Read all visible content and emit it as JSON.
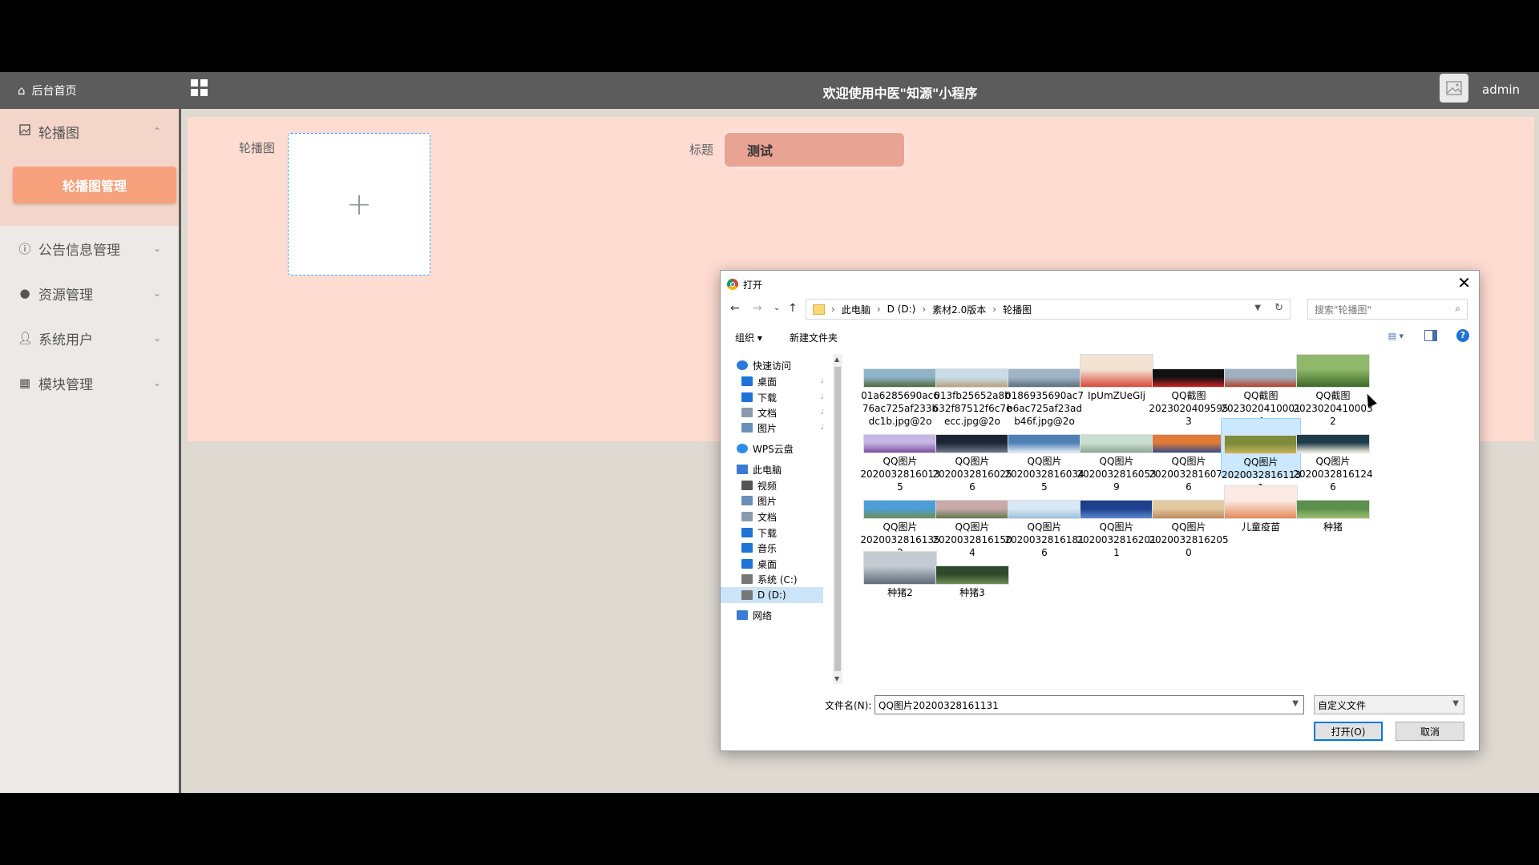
{
  "sidebar": {
    "home_label": "后台首页",
    "items": [
      {
        "label": "轮播图",
        "icon": "image-icon",
        "chevron": "⌃"
      },
      {
        "label": "公告信息管理",
        "icon": "info-icon",
        "chevron": "⌄"
      },
      {
        "label": "资源管理",
        "icon": "location-icon",
        "chevron": "⌄"
      },
      {
        "label": "系统用户",
        "icon": "user-icon",
        "chevron": "⌄"
      },
      {
        "label": "模块管理",
        "icon": "grid-icon",
        "chevron": "⌄"
      }
    ],
    "sub_active": "轮播图管理"
  },
  "header": {
    "title": "欢迎使用中医\"知源\"小程序",
    "user": "admin"
  },
  "form": {
    "carousel_label": "轮播图",
    "upload_plus": "+",
    "title_label": "标题",
    "title_value": "测试"
  },
  "dialog": {
    "title": "打开",
    "close": "✕",
    "nav": {
      "back": "←",
      "forward": "→",
      "recent": "⌄",
      "up": "↑"
    },
    "breadcrumb": [
      "此电脑",
      "D (D:)",
      "素材2.0版本",
      "轮播图"
    ],
    "breadcrumb_sep": "›",
    "search_placeholder": "搜索\"轮播图\"",
    "toolbar": {
      "organize": "组织 ▾",
      "new_folder": "新建文件夹",
      "help": "?"
    },
    "tree": [
      {
        "label": "快速访问",
        "icon": "star-icon",
        "indent": 0,
        "pin": false
      },
      {
        "label": "桌面",
        "icon": "desktop-icon",
        "indent": 1,
        "pin": true
      },
      {
        "label": "下载",
        "icon": "download-icon",
        "indent": 1,
        "pin": true
      },
      {
        "label": "文档",
        "icon": "document-icon",
        "indent": 1,
        "pin": true
      },
      {
        "label": "图片",
        "icon": "picture-icon",
        "indent": 1,
        "pin": true
      },
      {
        "label": "WPS云盘",
        "icon": "cloud-icon",
        "indent": 0,
        "pin": false
      },
      {
        "label": "此电脑",
        "icon": "computer-icon",
        "indent": 0,
        "pin": false
      },
      {
        "label": "视频",
        "icon": "video-icon",
        "indent": 1,
        "pin": false
      },
      {
        "label": "图片",
        "icon": "picture-icon",
        "indent": 1,
        "pin": false
      },
      {
        "label": "文档",
        "icon": "document-icon",
        "indent": 1,
        "pin": false
      },
      {
        "label": "下载",
        "icon": "download-icon",
        "indent": 1,
        "pin": false
      },
      {
        "label": "音乐",
        "icon": "music-icon",
        "indent": 1,
        "pin": false
      },
      {
        "label": "桌面",
        "icon": "desktop-icon",
        "indent": 1,
        "pin": false
      },
      {
        "label": "系统 (C:)",
        "icon": "drive-icon",
        "indent": 1,
        "pin": false
      },
      {
        "label": "D (D:)",
        "icon": "drive-icon",
        "indent": 1,
        "pin": false,
        "selected": true
      },
      {
        "label": "网络",
        "icon": "network-icon",
        "indent": 0,
        "pin": false
      }
    ],
    "files": [
      {
        "lines": [
          "01a6285690ac6",
          "76ac725af233b",
          "dc1b.jpg@2o"
        ],
        "colors": [
          "#8fb3c9",
          "#4f6b3a"
        ]
      },
      {
        "lines": [
          "013fb25652a8b",
          "632f87512f6c7e",
          "ecc.jpg@2o"
        ],
        "colors": [
          "#c9dde8",
          "#b7a37d"
        ]
      },
      {
        "lines": [
          "0186935690ac7",
          "b6ac725af23ad",
          "b46f.jpg@2o"
        ],
        "colors": [
          "#9fb4c6",
          "#5e6f7e"
        ]
      },
      {
        "lines": [
          "IpUmZUeGlj"
        ],
        "colors": [
          "#f3e3d3",
          "#d94b3c"
        ],
        "tall": true
      },
      {
        "lines": [
          "QQ截图",
          "2023020409595",
          "3"
        ],
        "colors": [
          "#111",
          "#c22"
        ]
      },
      {
        "lines": [
          "QQ截图",
          "2023020410001",
          "4"
        ],
        "colors": [
          "#9fb0c0",
          "#b4442c"
        ]
      },
      {
        "lines": [
          "QQ截图",
          "2023020410003",
          "2"
        ],
        "colors": [
          "#8fb86a",
          "#3c6a2a"
        ],
        "tall": true
      },
      {
        "lines": [
          "QQ图片",
          "2020032816013",
          "5"
        ],
        "colors": [
          "#c6b6e6",
          "#7b4f9e"
        ]
      },
      {
        "lines": [
          "QQ图片",
          "2020032816025",
          "6"
        ],
        "colors": [
          "#1b2535",
          "#6e7b8c"
        ]
      },
      {
        "lines": [
          "QQ图片",
          "2020032816034",
          "5"
        ],
        "colors": [
          "#4e7fb5",
          "#e3ecf4"
        ]
      },
      {
        "lines": [
          "QQ图片",
          "2020032816053",
          "9"
        ],
        "colors": [
          "#c9ddd0",
          "#8fa895"
        ]
      },
      {
        "lines": [
          "QQ图片",
          "2020032816074",
          "6"
        ],
        "colors": [
          "#e27b36",
          "#3a4b86"
        ]
      },
      {
        "lines": [
          "QQ图片",
          "2020032816113",
          "1"
        ],
        "colors": [
          "#7d8b3c",
          "#c8b55a"
        ],
        "selected": true
      },
      {
        "lines": [
          "QQ图片",
          "2020032816124",
          "6"
        ],
        "colors": [
          "#1d3c4a",
          "#f3f0e0"
        ]
      },
      {
        "lines": [
          "QQ图片",
          "2020032816135",
          "2"
        ],
        "colors": [
          "#4d9ed8",
          "#6f8f58"
        ]
      },
      {
        "lines": [
          "QQ图片",
          "2020032816150",
          "4"
        ],
        "colors": [
          "#c9a9a9",
          "#5e7a4c"
        ]
      },
      {
        "lines": [
          "QQ图片",
          "2020032816181",
          "6"
        ],
        "colors": [
          "#d8e8f4",
          "#9fc1da"
        ]
      },
      {
        "lines": [
          "QQ图片",
          "2020032816201",
          "1"
        ],
        "colors": [
          "#1d3f8c",
          "#5b87d0"
        ]
      },
      {
        "lines": [
          "QQ图片",
          "2020032816205",
          "0"
        ],
        "colors": [
          "#e3c9a0",
          "#c08a5c"
        ]
      },
      {
        "lines": [
          "儿童疫苗"
        ],
        "colors": [
          "#fbe9e3",
          "#e58b5b"
        ],
        "tall": true
      },
      {
        "lines": [
          "种猪"
        ],
        "colors": [
          "#5d8f4d",
          "#9bbf6f"
        ]
      },
      {
        "lines": [
          "种猪2"
        ],
        "colors": [
          "#c5cbd3",
          "#5d6a77"
        ],
        "tall": true
      },
      {
        "lines": [
          "种猪3"
        ],
        "colors": [
          "#2e4a2a",
          "#6d8a55"
        ]
      }
    ],
    "filename_label": "文件名(N):",
    "filename_value": "QQ图片20200328161131",
    "filetype_value": "自定义文件",
    "open_label": "打开(O)",
    "cancel_label": "取消"
  },
  "colors": {
    "accent": "#f8a17d",
    "header_bg": "#5c5c5c",
    "content_bg": "#ffdcd2",
    "selection": "#cce8ff"
  }
}
